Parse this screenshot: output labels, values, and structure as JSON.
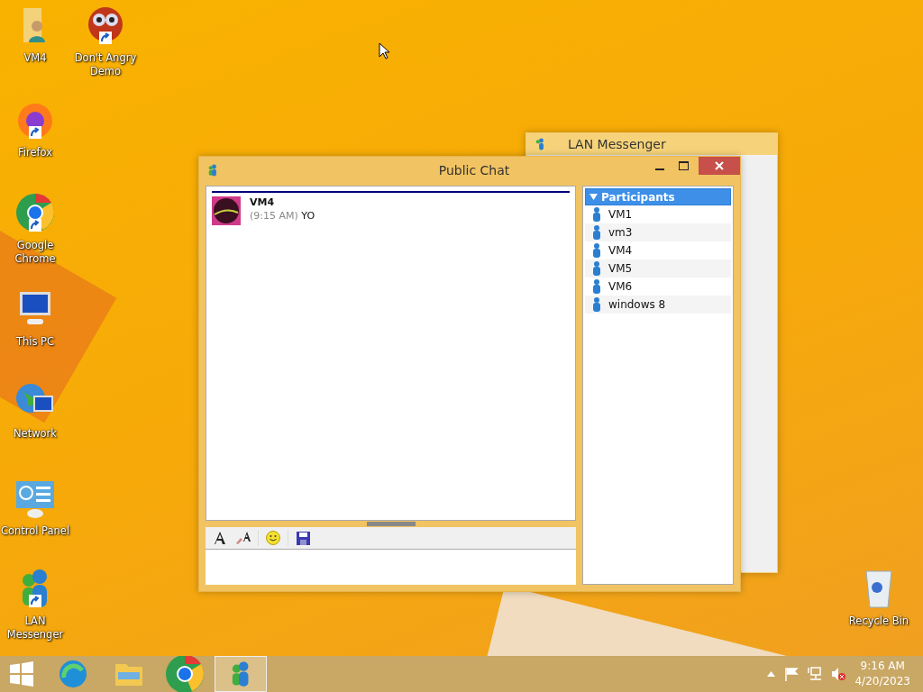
{
  "desktop_icons": [
    {
      "label": "VM4",
      "kind": "folder"
    },
    {
      "label": "Don't Angry Demo",
      "kind": "game"
    },
    {
      "label": "Firefox",
      "kind": "firefox"
    },
    {
      "label": "Google Chrome",
      "kind": "chrome"
    },
    {
      "label": "This PC",
      "kind": "pc"
    },
    {
      "label": "Network",
      "kind": "network"
    },
    {
      "label": "Control Panel",
      "kind": "control"
    },
    {
      "label": "LAN Messenger",
      "kind": "messenger"
    },
    {
      "label": "Recycle Bin",
      "kind": "bin"
    }
  ],
  "background_window": {
    "title": "LAN Messenger"
  },
  "chat_window": {
    "title": "Public Chat",
    "messages": [
      {
        "sender": "VM4",
        "time": "(9:15 AM)",
        "text": "YO"
      }
    ],
    "participants": {
      "header": "Participants",
      "expanded": true,
      "items": [
        "VM1",
        "vm3",
        "VM4",
        "VM5",
        "VM6",
        "windows 8"
      ]
    }
  },
  "taskbar": {
    "items": [
      {
        "kind": "edge",
        "selected": false
      },
      {
        "kind": "explorer",
        "selected": false
      },
      {
        "kind": "chrome",
        "selected": false
      },
      {
        "kind": "messenger",
        "selected": true
      }
    ],
    "time": "9:16 AM",
    "date": "4/20/2023"
  }
}
